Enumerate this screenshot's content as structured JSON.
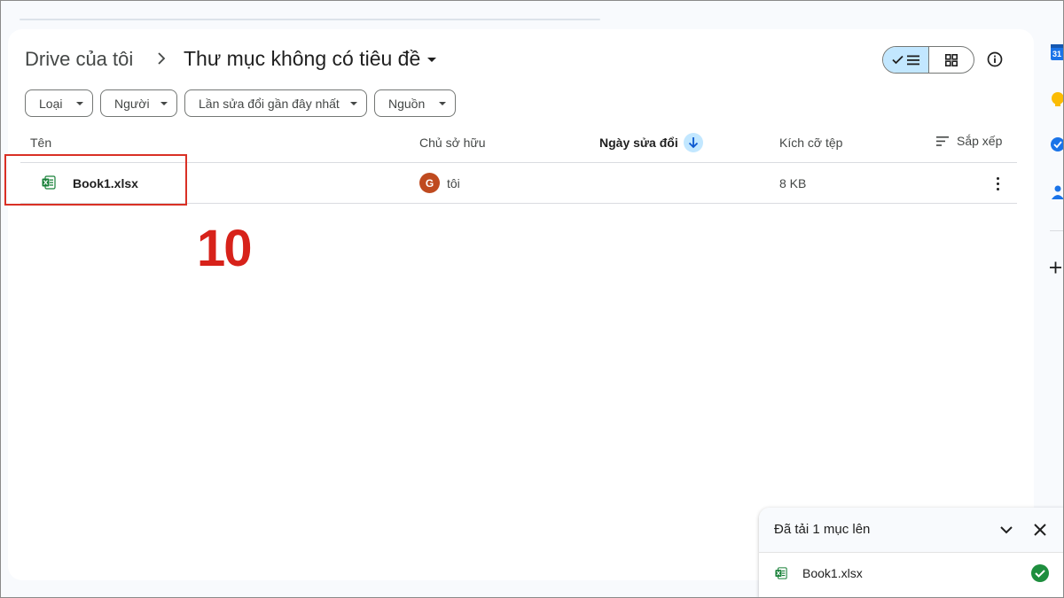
{
  "breadcrumb": {
    "root": "Drive của tôi",
    "current": "Thư mục không có tiêu đề"
  },
  "filters": [
    {
      "label": "Loại"
    },
    {
      "label": "Người"
    },
    {
      "label": "Lần sửa đổi gần đây nhất"
    },
    {
      "label": "Nguồn"
    }
  ],
  "columns": {
    "name": "Tên",
    "owner": "Chủ sở hữu",
    "modified": "Ngày sửa đổi",
    "size": "Kích cỡ tệp",
    "sort": "Sắp xếp"
  },
  "files": [
    {
      "name": "Book1.xlsx",
      "owner_initial": "G",
      "owner": "tôi",
      "size": "8 KB"
    }
  ],
  "annotation": {
    "step": "10"
  },
  "upload_panel": {
    "title": "Đã tải 1 mục lên",
    "file_name": "Book1.xlsx"
  },
  "colors": {
    "accent": "#c2e7ff",
    "annotation_red": "#d93025",
    "excel_green": "#188038",
    "success_green": "#1e8e3e",
    "avatar": "#bf4a1f"
  }
}
